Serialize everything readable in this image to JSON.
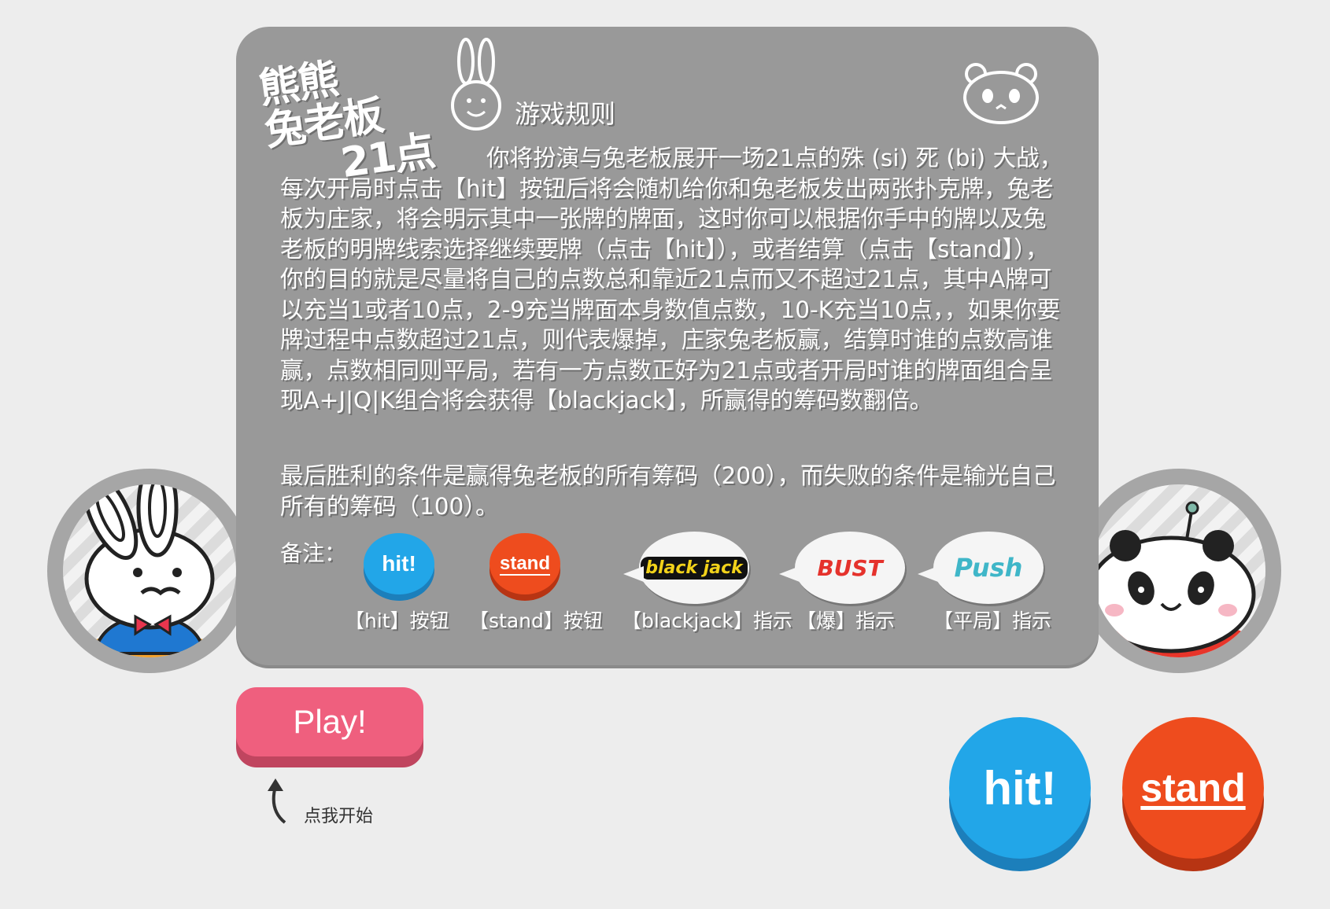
{
  "game": {
    "logo_text": [
      "熊熊",
      "兔老板",
      "21点"
    ],
    "rules_title": "游戏规则",
    "rules_text": "你将扮演与兔老板展开一场21点的殊 (si) 死 (bi) 大战，每次开局时点击【hit】按钮后将会随机给你和兔老板发出两张扑克牌，兔老板为庄家，将会明示其中一张牌的牌面，这时你可以根据你手中的牌以及兔老板的明牌线索选择继续要牌（点击【hit】），或者结算（点击【stand】），你的目的就是尽量将自己的点数总和靠近21点而又不超过21点，其中A牌可以充当1或者10点，2-9充当牌面本身数值点数，10-K充当10点，，如果你要牌过程中点数超过21点，则代表爆掉，庄家兔老板赢，结算时谁的点数高谁赢，点数相同则平局，若有一方点数正好为21点或者开局时谁的牌面组合呈现A+J|Q|K组合将会获得【blackjack】，所赢得的筹码数翻倍。",
    "win_text": "最后胜利的条件是赢得兔老板的所有筹码（200），而失败的条件是输光自己所有的筹码（100）。",
    "note_label": "备注："
  },
  "legend": [
    {
      "caption": "【hit】按钮",
      "graphic_label": "hit!"
    },
    {
      "caption": "【stand】按钮",
      "graphic_label": "stand"
    },
    {
      "caption": "【blackjack】指示",
      "graphic_label": "black jack"
    },
    {
      "caption": "【爆】指示",
      "graphic_label": "BUST"
    },
    {
      "caption": "【平局】指示",
      "graphic_label": "Push"
    }
  ],
  "controls": {
    "play_label": "Play!",
    "play_hint": "点我开始",
    "hit_label": "hit!",
    "stand_label": "stand"
  },
  "colors": {
    "panel": "#999999",
    "background": "#ededed",
    "hit": "#22a6e8",
    "stand": "#ee4c1e",
    "play": "#ef5f7e"
  }
}
